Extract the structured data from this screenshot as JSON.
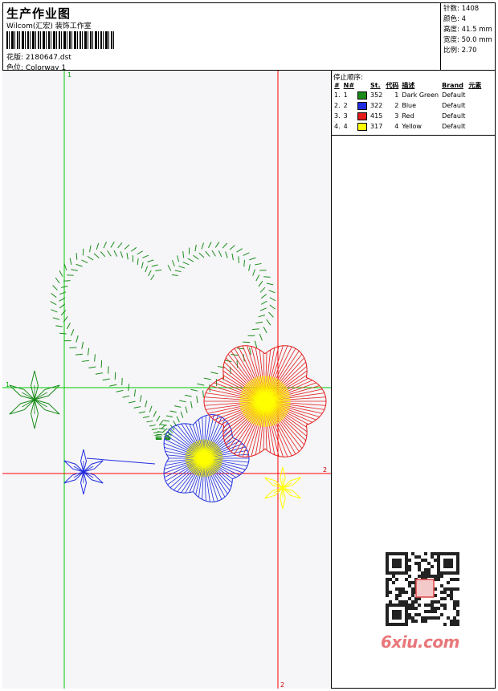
{
  "header": {
    "title": "生产作业图",
    "company": "Wilcom(汇宏) 装饰工作室",
    "design_label": "花版:",
    "design_value": "2180647.dst",
    "colorway_label": "色位:",
    "colorway_value": "Colorway 1"
  },
  "stats": {
    "stitches_label": "针数:",
    "stitches": "1408",
    "colors_label": "颜色:",
    "colors": "4",
    "height_label": "高度:",
    "height": "41.5 mm",
    "width_label": "宽度:",
    "width": "50.0 mm",
    "scale_label": "比例:",
    "scale": "2.70"
  },
  "stop_sequence": {
    "title": "停止顺序:",
    "headers": [
      "#",
      "N#",
      "St.",
      "代码",
      "描述",
      "Brand",
      "元素"
    ],
    "rows": [
      {
        "idx": "1.",
        "n": "1",
        "color": "#1a8c1a",
        "st": "352",
        "code": "1",
        "desc": "Dark Green",
        "brand": "Default"
      },
      {
        "idx": "2.",
        "n": "2",
        "color": "#1f2de0",
        "st": "322",
        "code": "2",
        "desc": "Blue",
        "brand": "Default"
      },
      {
        "idx": "3.",
        "n": "3",
        "color": "#e51a1a",
        "st": "415",
        "code": "3",
        "desc": "Red",
        "brand": "Default"
      },
      {
        "idx": "4.",
        "n": "4",
        "color": "#ffff00",
        "st": "317",
        "code": "4",
        "desc": "Yellow",
        "brand": "Default"
      }
    ]
  },
  "canvas": {
    "marker_1_top": "1",
    "marker_1_left": "1",
    "marker_2_right": "2",
    "marker_2_bottom": "2",
    "green_line_color": "#00cc00",
    "red_line_color": "#ff0000"
  },
  "watermark": "6xiu.com"
}
